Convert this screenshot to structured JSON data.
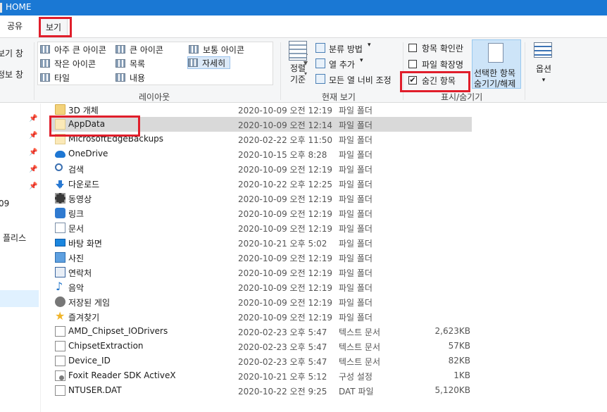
{
  "window": {
    "title": "HOME"
  },
  "ribbon_tabs": {
    "share": "공유",
    "view": "보기"
  },
  "ribbon": {
    "nav_partial": {
      "preview": "보기 창",
      "details": "정보 창"
    },
    "layout": {
      "items": [
        "아주 큰 아이콘",
        "큰 아이콘",
        "보통 아이콘",
        "작은 아이콘",
        "목록",
        "자세히",
        "타일",
        "내용"
      ],
      "selected": "자세히",
      "group_label": "레이아웃"
    },
    "current_view": {
      "sort_label_1": "정렬",
      "sort_label_2": "기준",
      "group_by": "분류 방법",
      "add_columns": "열 추가",
      "fit_columns": "모든 열 너비 조정",
      "group_label": "현재 보기"
    },
    "show_hide": {
      "item_checkboxes": {
        "label": "항목 확인란",
        "checked": false
      },
      "file_extensions": {
        "label": "파일 확장명",
        "checked": false
      },
      "hidden_items": {
        "label": "숨긴 항목",
        "checked": true
      },
      "hide_selected_1": "선택한 항목",
      "hide_selected_2": "숨기기/해제",
      "group_label": "표시/숨기기"
    },
    "options": {
      "label": "옵션"
    }
  },
  "nav_pane": {
    "partial_1": "09",
    "partial_2": "플리스"
  },
  "files": [
    {
      "name": "3D 개체",
      "date": "2020-10-09 오전 12:19",
      "type": "파일 폴더",
      "size": "",
      "icon": "folder-3d"
    },
    {
      "name": "AppData",
      "date": "2020-10-09 오전 12:14",
      "type": "파일 폴더",
      "size": "",
      "icon": "folder-hidden"
    },
    {
      "name": "MicrosoftEdgeBackups",
      "date": "2020-02-22 오후 11:50",
      "type": "파일 폴더",
      "size": "",
      "icon": "folder-hidden"
    },
    {
      "name": "OneDrive",
      "date": "2020-10-15 오후 8:28",
      "type": "파일 폴더",
      "size": "",
      "icon": "onedrive"
    },
    {
      "name": "검색",
      "date": "2020-10-09 오전 12:19",
      "type": "파일 폴더",
      "size": "",
      "icon": "search"
    },
    {
      "name": "다운로드",
      "date": "2020-10-22 오후 12:25",
      "type": "파일 폴더",
      "size": "",
      "icon": "download"
    },
    {
      "name": "동영상",
      "date": "2020-10-09 오전 12:19",
      "type": "파일 폴더",
      "size": "",
      "icon": "video"
    },
    {
      "name": "링크",
      "date": "2020-10-09 오전 12:19",
      "type": "파일 폴더",
      "size": "",
      "icon": "link"
    },
    {
      "name": "문서",
      "date": "2020-10-09 오전 12:19",
      "type": "파일 폴더",
      "size": "",
      "icon": "documents"
    },
    {
      "name": "바탕 화면",
      "date": "2020-10-21 오후 5:02",
      "type": "파일 폴더",
      "size": "",
      "icon": "desktop"
    },
    {
      "name": "사진",
      "date": "2020-10-09 오전 12:19",
      "type": "파일 폴더",
      "size": "",
      "icon": "pictures"
    },
    {
      "name": "연락처",
      "date": "2020-10-09 오전 12:19",
      "type": "파일 폴더",
      "size": "",
      "icon": "contacts"
    },
    {
      "name": "음악",
      "date": "2020-10-09 오전 12:19",
      "type": "파일 폴더",
      "size": "",
      "icon": "music"
    },
    {
      "name": "저장된 게임",
      "date": "2020-10-09 오전 12:19",
      "type": "파일 폴더",
      "size": "",
      "icon": "saved-games"
    },
    {
      "name": "즐겨찾기",
      "date": "2020-10-09 오전 12:19",
      "type": "파일 폴더",
      "size": "",
      "icon": "favorites"
    },
    {
      "name": "AMD_Chipset_IODrivers",
      "date": "2020-02-23 오후 5:47",
      "type": "텍스트 문서",
      "size": "2,623KB",
      "icon": "text-file"
    },
    {
      "name": "ChipsetExtraction",
      "date": "2020-02-23 오후 5:47",
      "type": "텍스트 문서",
      "size": "57KB",
      "icon": "text-file"
    },
    {
      "name": "Device_ID",
      "date": "2020-02-23 오후 5:47",
      "type": "텍스트 문서",
      "size": "82KB",
      "icon": "text-file"
    },
    {
      "name": "Foxit Reader SDK ActiveX",
      "date": "2020-10-21 오후 5:12",
      "type": "구성 설정",
      "size": "1KB",
      "icon": "config-file"
    },
    {
      "name": "NTUSER.DAT",
      "date": "2020-10-22 오전 9:25",
      "type": "DAT 파일",
      "size": "5,120KB",
      "icon": "dat-file"
    }
  ],
  "selected_row": "AppData"
}
